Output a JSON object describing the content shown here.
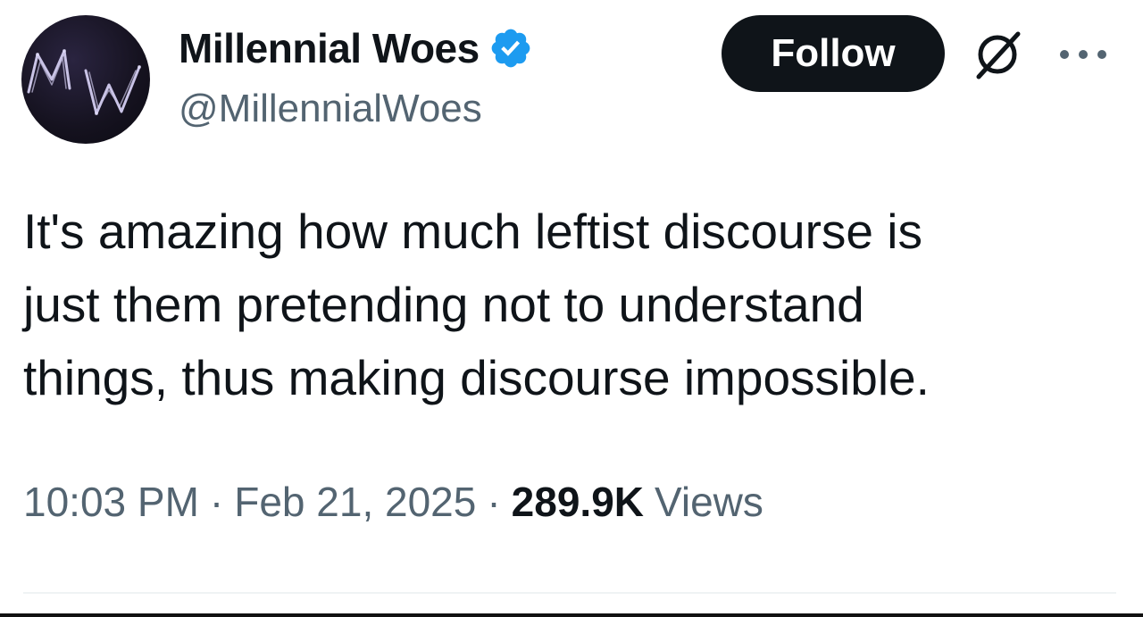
{
  "author": {
    "display_name": "Millennial Woes",
    "handle": "@MillennialWoes",
    "avatar_text": "MW",
    "verified": true,
    "verified_color": "#1d9bf0"
  },
  "actions": {
    "follow_label": "Follow",
    "grok_icon": "grok-slash-circle-icon",
    "more_icon": "more-horizontal-icon"
  },
  "tweet": {
    "text": "It's amazing how much leftist discourse is\njust them pretending not to understand\nthings, thus making discourse impossible."
  },
  "meta": {
    "time": "10:03 PM",
    "separator": "·",
    "date": "Feb 21, 2025",
    "views_count": "289.9K",
    "views_label": "Views"
  },
  "colors": {
    "text_primary": "#0f1419",
    "text_secondary": "#536471",
    "follow_bg": "#0f1419",
    "follow_text": "#ffffff",
    "divider": "#eff3f4"
  }
}
